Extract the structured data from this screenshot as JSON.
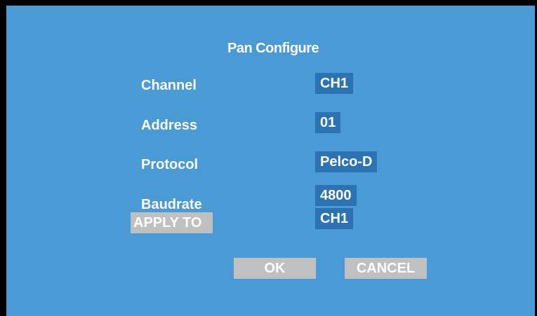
{
  "dialog": {
    "title": "Pan Configure"
  },
  "fields": {
    "channel": {
      "label": "Channel",
      "value": "CH1"
    },
    "address": {
      "label": "Address",
      "value": "01"
    },
    "protocol": {
      "label": "Protocol",
      "value": "Pelco-D"
    },
    "baudrate": {
      "label": "Baudrate",
      "value": "4800"
    },
    "apply_to": {
      "label": "APPLY TO",
      "value": "CH1"
    }
  },
  "buttons": {
    "ok_label": "OK",
    "cancel_label": "CANCEL"
  },
  "colors": {
    "background": "#4a9ad6",
    "value_box": "#2b73b2",
    "button": "#c0c0c0",
    "text": "#ffffff",
    "border": "#000000"
  }
}
